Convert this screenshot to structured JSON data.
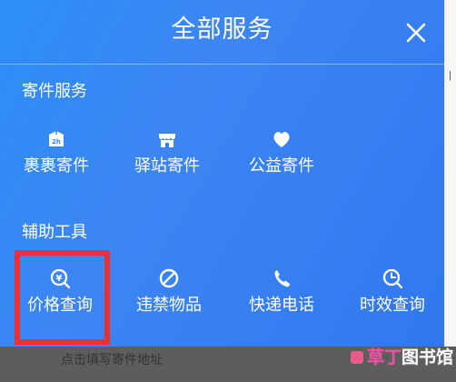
{
  "header": {
    "title": "全部服务",
    "close_icon": "close-icon"
  },
  "sections": {
    "services": {
      "title": "寄件服务",
      "items": [
        {
          "label": "裹裹寄件",
          "icon": "package-2h-icon"
        },
        {
          "label": "驿站寄件",
          "icon": "station-store-icon"
        },
        {
          "label": "公益寄件",
          "icon": "heart-icon"
        }
      ]
    },
    "tools": {
      "title": "辅助工具",
      "items": [
        {
          "label": "价格查询",
          "icon": "price-search-icon"
        },
        {
          "label": "违禁物品",
          "icon": "prohibited-icon"
        },
        {
          "label": "快递电话",
          "icon": "phone-icon"
        },
        {
          "label": "时效查询",
          "icon": "clock-search-icon"
        }
      ]
    }
  },
  "bottom": {
    "hint": "点击填写寄件地址"
  },
  "watermark": {
    "text": "草丁图书馆",
    "accent": "草丁",
    "rest": "图书馆"
  },
  "colors": {
    "panel_blue": "#2f85f4",
    "highlight_red": "#ea2f35",
    "white": "#ffffff"
  }
}
